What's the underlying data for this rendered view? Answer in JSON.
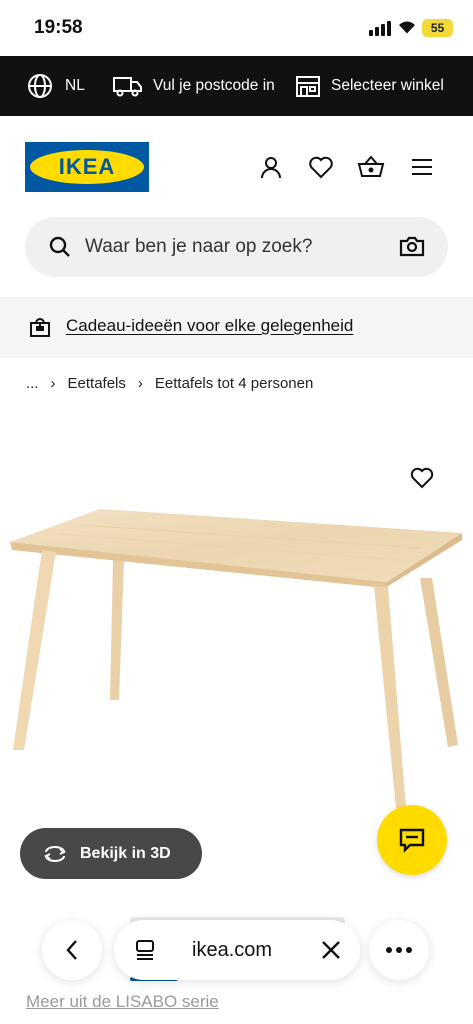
{
  "status_bar": {
    "time": "19:58",
    "battery": "55"
  },
  "top_bar": {
    "language": "NL",
    "postcode": "Vul je postcode in",
    "store": "Selecteer winkel"
  },
  "header": {
    "logo_text": "IKEA"
  },
  "search": {
    "placeholder": "Waar ben je naar op zoek?"
  },
  "promo": {
    "text": "Cadeau-ideeën voor elke gelegenheid"
  },
  "breadcrumb": {
    "ellipsis": "...",
    "items": [
      "Eettafels",
      "Eettafels tot 4 personen"
    ]
  },
  "product": {
    "view_3d_label": "Bekijk in 3D"
  },
  "browser": {
    "url": "ikea.com"
  },
  "series_link": "Meer uit de LISABO serie",
  "colors": {
    "ikea_blue": "#0058a3",
    "ikea_yellow": "#ffdb00",
    "top_bar_bg": "#111111"
  }
}
